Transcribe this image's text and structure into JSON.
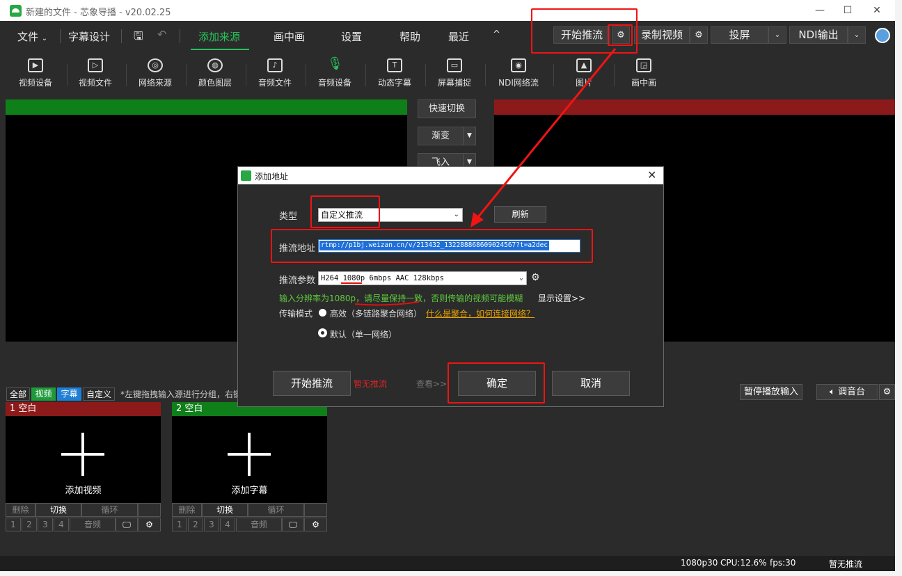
{
  "window": {
    "title": "新建的文件 - 芯象导播 - v20.02.25",
    "controls": [
      "—",
      "☐",
      "✕"
    ]
  },
  "menu": {
    "file": "文件",
    "subtitle_design": "字幕设计",
    "add_source": "添加来源",
    "pip": "画中画",
    "settings": "设置",
    "help": "帮助",
    "recent": "最近",
    "collapse": "^"
  },
  "top_actions": {
    "start_stream": "开始推流",
    "record": "录制视频",
    "cast": "投屏",
    "ndi_out": "NDI输出"
  },
  "sources": [
    {
      "label": "视频设备",
      "icon": "video-camera-icon"
    },
    {
      "label": "视频文件",
      "icon": "play-file-icon"
    },
    {
      "label": "网络来源",
      "icon": "network-icon"
    },
    {
      "label": "颜色图层",
      "icon": "palette-icon"
    },
    {
      "label": "音频文件",
      "icon": "music-file-icon"
    },
    {
      "label": "音频设备",
      "icon": "microphone-icon"
    },
    {
      "label": "动态字幕",
      "icon": "text-icon"
    },
    {
      "label": "屏幕捕捉",
      "icon": "monitor-icon"
    },
    {
      "label": "NDI网络流",
      "icon": "ndi-icon"
    },
    {
      "label": "图片",
      "icon": "image-icon"
    },
    {
      "label": "画中画",
      "icon": "pip-icon"
    }
  ],
  "transition": {
    "quick_switch": "快速切换",
    "fade": "渐变",
    "fly_in": "飞入"
  },
  "filters": {
    "all": "全部",
    "video": "视频",
    "subtitle": "字幕",
    "custom": "自定义",
    "hint": "*左键拖拽输入源进行分组，右键"
  },
  "cards": [
    {
      "head": "1 空白",
      "label": "添加视频",
      "color": "#8c1a1a"
    },
    {
      "head": "2 空白",
      "label": "添加字幕",
      "color": "#0f7f1a"
    }
  ],
  "card_controls": {
    "delete": "删除",
    "switch": "切换",
    "loop": "循环",
    "nums": [
      "1",
      "2",
      "3",
      "4"
    ],
    "audio": "音频"
  },
  "lower_right": {
    "pause_input": "暂停播放输入",
    "mixer": "调音台"
  },
  "status": {
    "resolution": "1080p30",
    "cpu": "CPU:12.6%",
    "fps": "fps:30",
    "stream_state": "暂无推流"
  },
  "dialog": {
    "title": "添加地址",
    "type_label": "类型",
    "type_value": "自定义推流",
    "refresh": "刷新",
    "url_label": "推流地址",
    "url_value": "rtmp://p1bj.weizan.cn/v/213432_132288868609024567?t=a2dec",
    "params_label": "推流参数",
    "params_value": "H264 1080p 6mbps AAC 128kbps",
    "note": "输入分辨率为1080p，请尽量保持一致，否则传输的视频可能模糊",
    "show_settings": "显示设置>>",
    "mode_label": "传输模式",
    "mode_efficient": "高效（多链路聚合网络）",
    "mode_link": "什么是聚合，如何连接网络？",
    "mode_default": "默认（单一网络）",
    "start_stream": "开始推流",
    "no_stream": "暂无推流",
    "view": "查看>>",
    "ok": "确定",
    "cancel": "取消"
  },
  "colors": {
    "accent_green": "#27c25a",
    "annotation_red": "#f01414"
  }
}
